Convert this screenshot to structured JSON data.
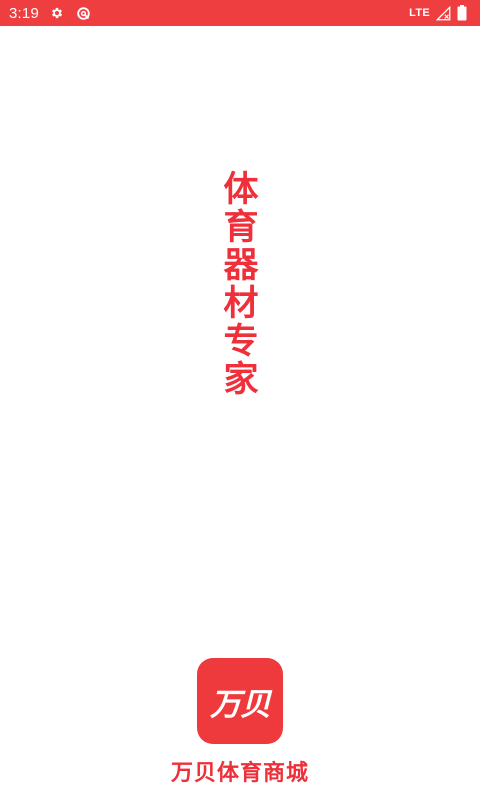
{
  "status_bar": {
    "time": "3:19",
    "network": "LTE",
    "background_color": "#ef3e40",
    "icons": [
      "gear-icon",
      "sync-icon",
      "signal-icon",
      "battery-icon"
    ]
  },
  "splash": {
    "slogan_chars": [
      "体",
      "育",
      "器",
      "材",
      "专",
      "家"
    ],
    "slogan_color": "#ef2f39",
    "logo_text": "万贝",
    "logo_color": "#ee3a3c",
    "app_name": "万贝体育商城"
  }
}
